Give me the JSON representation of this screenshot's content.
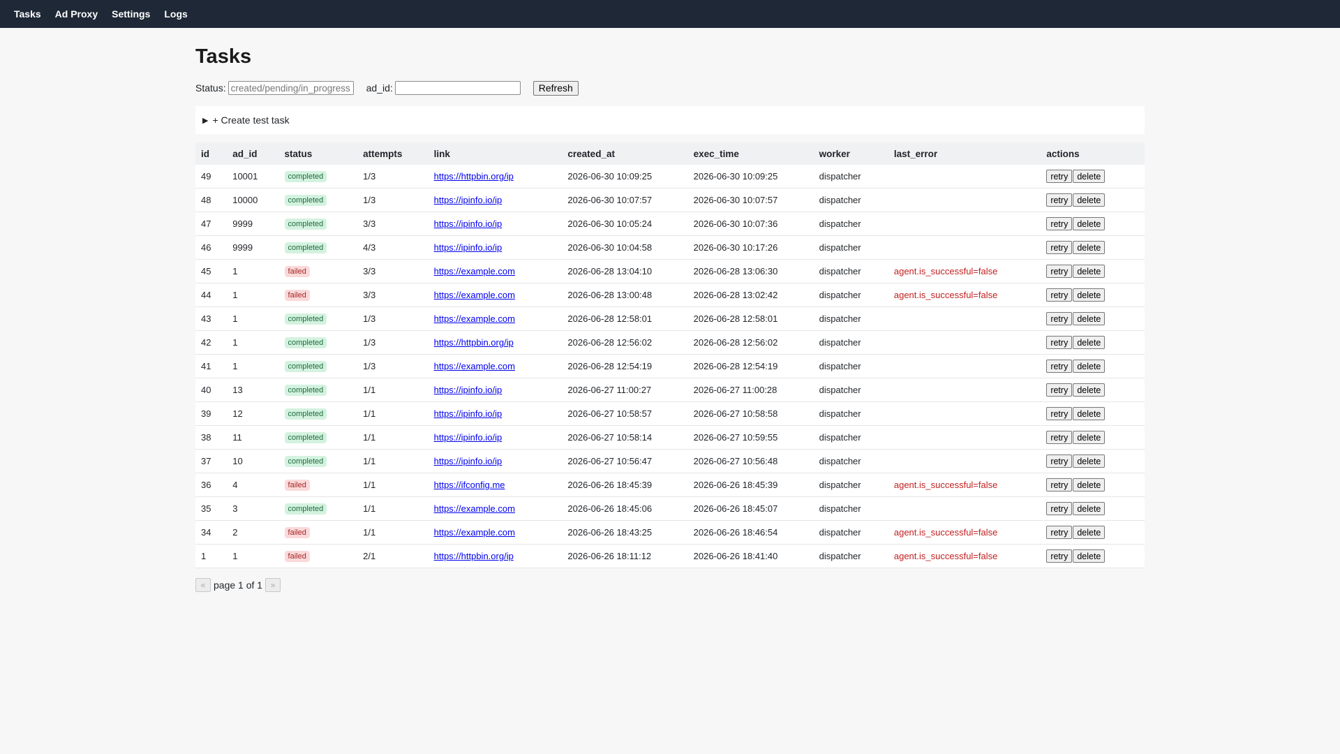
{
  "nav": [
    "Tasks",
    "Ad Proxy",
    "Settings",
    "Logs"
  ],
  "page_title": "Tasks",
  "filters": {
    "status_label": "Status:",
    "status_placeholder": "created/pending/in_progress",
    "adid_label": "ad_id:",
    "adid_value": "",
    "refresh_label": "Refresh"
  },
  "create_label": "+ Create test task",
  "table": {
    "columns": [
      "id",
      "ad_id",
      "status",
      "attempts",
      "link",
      "created_at",
      "exec_time",
      "worker",
      "last_error",
      "actions"
    ],
    "retry_label": "retry",
    "delete_label": "delete",
    "rows": [
      {
        "id": "49",
        "ad_id": "10001",
        "status": "completed",
        "attempts": "1/3",
        "link": "https://httpbin.org/ip",
        "created_at": "2026-06-30 10:09:25",
        "exec_time": "2026-06-30 10:09:25",
        "worker": "dispatcher",
        "last_error": ""
      },
      {
        "id": "48",
        "ad_id": "10000",
        "status": "completed",
        "attempts": "1/3",
        "link": "https://ipinfo.io/ip",
        "created_at": "2026-06-30 10:07:57",
        "exec_time": "2026-06-30 10:07:57",
        "worker": "dispatcher",
        "last_error": ""
      },
      {
        "id": "47",
        "ad_id": "9999",
        "status": "completed",
        "attempts": "3/3",
        "link": "https://ipinfo.io/ip",
        "created_at": "2026-06-30 10:05:24",
        "exec_time": "2026-06-30 10:07:36",
        "worker": "dispatcher",
        "last_error": ""
      },
      {
        "id": "46",
        "ad_id": "9999",
        "status": "completed",
        "attempts": "4/3",
        "link": "https://ipinfo.io/ip",
        "created_at": "2026-06-30 10:04:58",
        "exec_time": "2026-06-30 10:17:26",
        "worker": "dispatcher",
        "last_error": ""
      },
      {
        "id": "45",
        "ad_id": "1",
        "status": "failed",
        "attempts": "3/3",
        "link": "https://example.com",
        "created_at": "2026-06-28 13:04:10",
        "exec_time": "2026-06-28 13:06:30",
        "worker": "dispatcher",
        "last_error": "agent.is_successful=false"
      },
      {
        "id": "44",
        "ad_id": "1",
        "status": "failed",
        "attempts": "3/3",
        "link": "https://example.com",
        "created_at": "2026-06-28 13:00:48",
        "exec_time": "2026-06-28 13:02:42",
        "worker": "dispatcher",
        "last_error": "agent.is_successful=false"
      },
      {
        "id": "43",
        "ad_id": "1",
        "status": "completed",
        "attempts": "1/3",
        "link": "https://example.com",
        "created_at": "2026-06-28 12:58:01",
        "exec_time": "2026-06-28 12:58:01",
        "worker": "dispatcher",
        "last_error": ""
      },
      {
        "id": "42",
        "ad_id": "1",
        "status": "completed",
        "attempts": "1/3",
        "link": "https://httpbin.org/ip",
        "created_at": "2026-06-28 12:56:02",
        "exec_time": "2026-06-28 12:56:02",
        "worker": "dispatcher",
        "last_error": ""
      },
      {
        "id": "41",
        "ad_id": "1",
        "status": "completed",
        "attempts": "1/3",
        "link": "https://example.com",
        "created_at": "2026-06-28 12:54:19",
        "exec_time": "2026-06-28 12:54:19",
        "worker": "dispatcher",
        "last_error": ""
      },
      {
        "id": "40",
        "ad_id": "13",
        "status": "completed",
        "attempts": "1/1",
        "link": "https://ipinfo.io/ip",
        "created_at": "2026-06-27 11:00:27",
        "exec_time": "2026-06-27 11:00:28",
        "worker": "dispatcher",
        "last_error": ""
      },
      {
        "id": "39",
        "ad_id": "12",
        "status": "completed",
        "attempts": "1/1",
        "link": "https://ipinfo.io/ip",
        "created_at": "2026-06-27 10:58:57",
        "exec_time": "2026-06-27 10:58:58",
        "worker": "dispatcher",
        "last_error": ""
      },
      {
        "id": "38",
        "ad_id": "11",
        "status": "completed",
        "attempts": "1/1",
        "link": "https://ipinfo.io/ip",
        "created_at": "2026-06-27 10:58:14",
        "exec_time": "2026-06-27 10:59:55",
        "worker": "dispatcher",
        "last_error": ""
      },
      {
        "id": "37",
        "ad_id": "10",
        "status": "completed",
        "attempts": "1/1",
        "link": "https://ipinfo.io/ip",
        "created_at": "2026-06-27 10:56:47",
        "exec_time": "2026-06-27 10:56:48",
        "worker": "dispatcher",
        "last_error": ""
      },
      {
        "id": "36",
        "ad_id": "4",
        "status": "failed",
        "attempts": "1/1",
        "link": "https://ifconfig.me",
        "created_at": "2026-06-26 18:45:39",
        "exec_time": "2026-06-26 18:45:39",
        "worker": "dispatcher",
        "last_error": "agent.is_successful=false"
      },
      {
        "id": "35",
        "ad_id": "3",
        "status": "completed",
        "attempts": "1/1",
        "link": "https://example.com",
        "created_at": "2026-06-26 18:45:06",
        "exec_time": "2026-06-26 18:45:07",
        "worker": "dispatcher",
        "last_error": ""
      },
      {
        "id": "34",
        "ad_id": "2",
        "status": "failed",
        "attempts": "1/1",
        "link": "https://example.com",
        "created_at": "2026-06-26 18:43:25",
        "exec_time": "2026-06-26 18:46:54",
        "worker": "dispatcher",
        "last_error": "agent.is_successful=false"
      },
      {
        "id": "1",
        "ad_id": "1",
        "status": "failed",
        "attempts": "2/1",
        "link": "https://httpbin.org/ip",
        "created_at": "2026-06-26 18:11:12",
        "exec_time": "2026-06-26 18:41:40",
        "worker": "dispatcher",
        "last_error": "agent.is_successful=false"
      }
    ]
  },
  "pager": {
    "prev": "«",
    "text": "page 1 of 1",
    "next": "»"
  },
  "colors": {
    "topbar": "#1e2836",
    "completed_bg": "#d3f2df",
    "failed_bg": "#fbd9d9",
    "error_text": "#c21f1f",
    "link": "#0000ee"
  }
}
